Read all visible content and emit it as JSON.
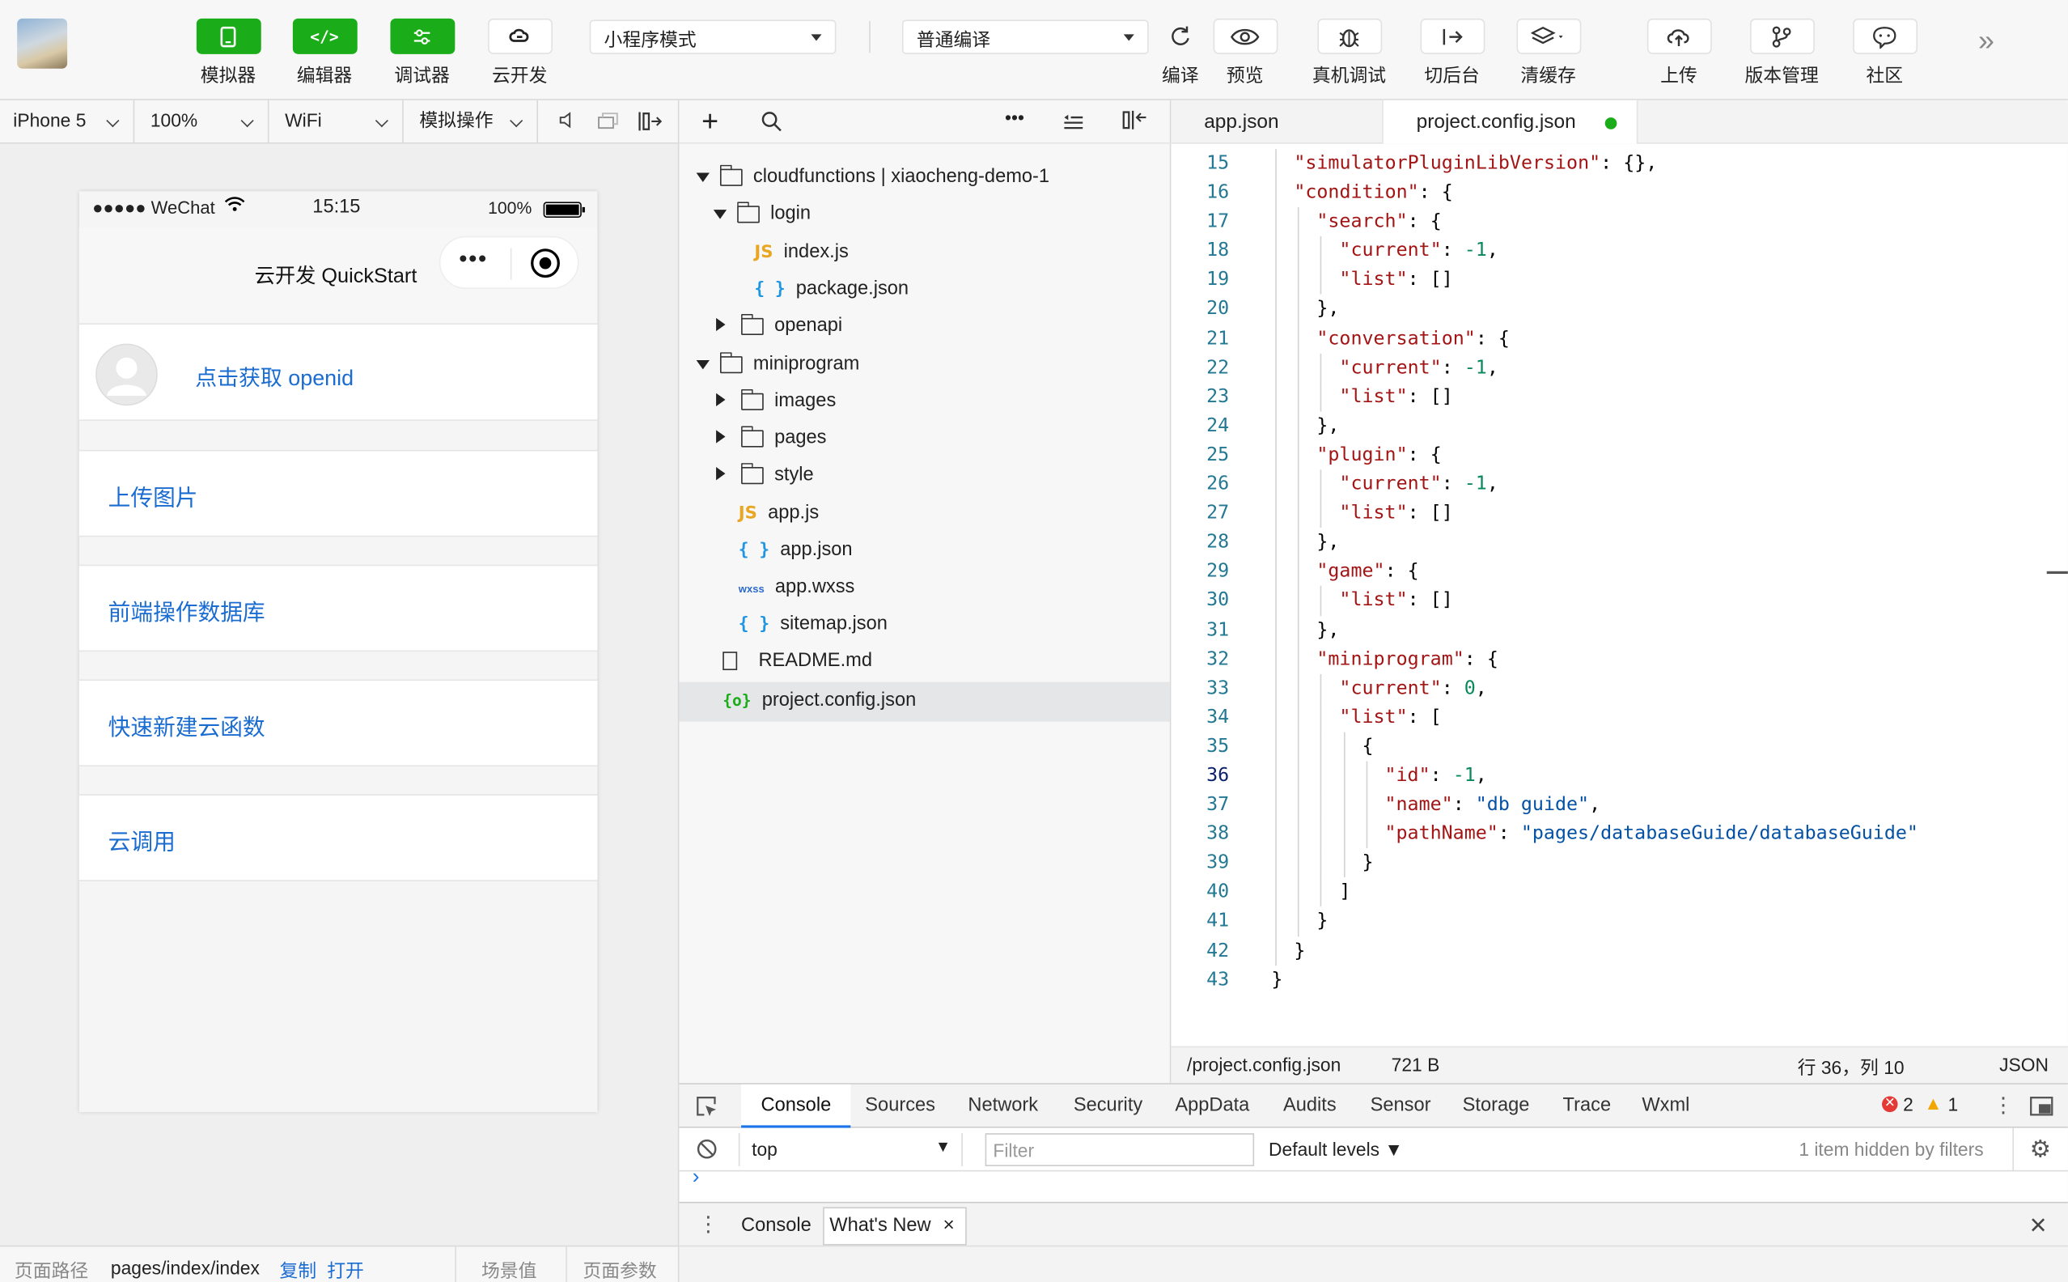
{
  "toolbar": {
    "buttons": [
      {
        "label": "模拟器",
        "icon": "phone-icon"
      },
      {
        "label": "编辑器",
        "icon": "code-icon"
      },
      {
        "label": "调试器",
        "icon": "debug-icon"
      },
      {
        "label": "云开发",
        "icon": "cloud-link-icon"
      }
    ],
    "mode_select": "小程序模式",
    "compile_select": "普通编译",
    "actions": [
      {
        "label": "编译",
        "icon": "refresh-icon"
      },
      {
        "label": "预览",
        "icon": "eye-icon"
      },
      {
        "label": "真机调试",
        "icon": "bug-icon"
      },
      {
        "label": "切后台",
        "icon": "switch-icon"
      },
      {
        "label": "清缓存",
        "icon": "layers-icon"
      },
      {
        "label": "上传",
        "icon": "upload-cloud-icon"
      },
      {
        "label": "版本管理",
        "icon": "branch-icon"
      },
      {
        "label": "社区",
        "icon": "chat-icon"
      }
    ]
  },
  "simbar": {
    "device": "iPhone 5",
    "zoom": "100%",
    "network": "WiFi",
    "ops": "模拟操作"
  },
  "phone": {
    "carrier": "●●●●● WeChat",
    "time": "15:15",
    "battery": "100%",
    "nav_title": "云开发 QuickStart",
    "openid_label": "点击获取 openid",
    "items": [
      "上传图片",
      "前端操作数据库",
      "快速新建云函数",
      "云调用"
    ]
  },
  "sim_footer": {
    "path_label": "页面路径",
    "path": "pages/index/index",
    "copy": "复制",
    "open": "打开",
    "scene": "场景值",
    "params": "页面参数"
  },
  "tree": {
    "root": "cloudfunctions | xiaocheng-demo-1",
    "login": "login",
    "index_js": "index.js",
    "package_json": "package.json",
    "openapi": "openapi",
    "miniprogram": "miniprogram",
    "images": "images",
    "pages": "pages",
    "style": "style",
    "app_js": "app.js",
    "app_json": "app.json",
    "app_wxss": "app.wxss",
    "sitemap": "sitemap.json",
    "readme": "README.md",
    "project_config": "project.config.json"
  },
  "editor": {
    "tab1": "app.json",
    "tab2": "project.config.json",
    "lines": [
      {
        "n": "15",
        "indent": 1,
        "html": "\"simulatorPluginLibVersion\": {},"
      },
      {
        "n": "16",
        "indent": 1,
        "html": "\"condition\": {"
      },
      {
        "n": "17",
        "indent": 2,
        "html": "\"search\": {"
      },
      {
        "n": "18",
        "indent": 3,
        "html": "\"current\": -1,"
      },
      {
        "n": "19",
        "indent": 3,
        "html": "\"list\": []"
      },
      {
        "n": "20",
        "indent": 2,
        "html": "},"
      },
      {
        "n": "21",
        "indent": 2,
        "html": "\"conversation\": {"
      },
      {
        "n": "22",
        "indent": 3,
        "html": "\"current\": -1,"
      },
      {
        "n": "23",
        "indent": 3,
        "html": "\"list\": []"
      },
      {
        "n": "24",
        "indent": 2,
        "html": "},"
      },
      {
        "n": "25",
        "indent": 2,
        "html": "\"plugin\": {"
      },
      {
        "n": "26",
        "indent": 3,
        "html": "\"current\": -1,"
      },
      {
        "n": "27",
        "indent": 3,
        "html": "\"list\": []"
      },
      {
        "n": "28",
        "indent": 2,
        "html": "},"
      },
      {
        "n": "29",
        "indent": 2,
        "html": "\"game\": {"
      },
      {
        "n": "30",
        "indent": 3,
        "html": "\"list\": []"
      },
      {
        "n": "31",
        "indent": 2,
        "html": "},"
      },
      {
        "n": "32",
        "indent": 2,
        "html": "\"miniprogram\": {"
      },
      {
        "n": "33",
        "indent": 3,
        "html": "\"current\": 0,"
      },
      {
        "n": "34",
        "indent": 3,
        "html": "\"list\": ["
      },
      {
        "n": "35",
        "indent": 4,
        "html": "{"
      },
      {
        "n": "36",
        "indent": 5,
        "html": "\"id\": -1,"
      },
      {
        "n": "37",
        "indent": 5,
        "html": "\"name\": \"db guide\","
      },
      {
        "n": "38",
        "indent": 5,
        "html": "\"pathName\": \"pages/databaseGuide/databaseGuide\""
      },
      {
        "n": "39",
        "indent": 4,
        "html": "}"
      },
      {
        "n": "40",
        "indent": 3,
        "html": "]"
      },
      {
        "n": "41",
        "indent": 2,
        "html": "}"
      },
      {
        "n": "42",
        "indent": 1,
        "html": "}"
      },
      {
        "n": "43",
        "indent": 0,
        "html": "}"
      }
    ],
    "footer_path": "/project.config.json",
    "footer_size": "721 B",
    "footer_pos": "行 36，列 10",
    "footer_lang": "JSON"
  },
  "devtools": {
    "tabs": [
      "Console",
      "Sources",
      "Network",
      "Security",
      "AppData",
      "Audits",
      "Sensor",
      "Storage",
      "Trace",
      "Wxml"
    ],
    "errors": "2",
    "warnings": "1",
    "context": "top",
    "filter_placeholder": "Filter",
    "levels": "Default levels ▼",
    "hidden": "1 item hidden by filters",
    "prompt": "›",
    "drawer_tabs": [
      "Console",
      "What's New"
    ]
  }
}
